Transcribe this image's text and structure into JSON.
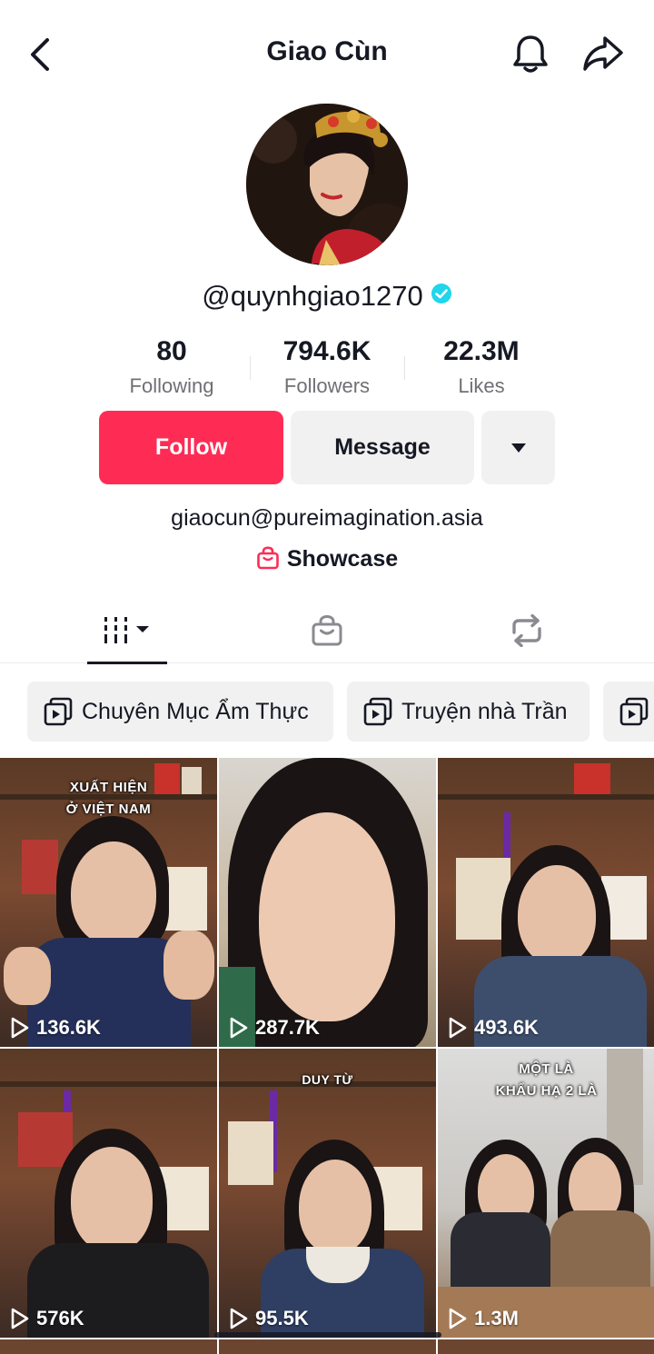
{
  "header": {
    "title": "Giao Cùn",
    "back_icon": "chevron-left-icon",
    "bell_icon": "bell-icon",
    "share_icon": "share-arrow-icon"
  },
  "profile": {
    "username": "@quynhgiao1270",
    "verified": true,
    "verified_color": "#20d5ec"
  },
  "stats": [
    {
      "value": "80",
      "label": "Following"
    },
    {
      "value": "794.6K",
      "label": "Followers"
    },
    {
      "value": "22.3M",
      "label": "Likes"
    }
  ],
  "actions": {
    "follow_label": "Follow",
    "message_label": "Message",
    "more_icon": "caret-down-icon",
    "follow_color": "#fe2c55"
  },
  "bio": {
    "email": "giaocun@pureimagination.asia",
    "showcase_label": "Showcase",
    "showcase_icon": "shopping-bag-icon"
  },
  "tabs": [
    {
      "name": "videos",
      "icon": "grid-icon",
      "active": true
    },
    {
      "name": "shop",
      "icon": "shop-bag-icon",
      "active": false
    },
    {
      "name": "reposts",
      "icon": "repost-icon",
      "active": false
    }
  ],
  "playlists": [
    {
      "label": "Chuyên Mục Ẩm Thực",
      "icon": "playlist-icon"
    },
    {
      "label": "Truyện nhà Trần",
      "icon": "playlist-icon"
    },
    {
      "label": "",
      "icon": "playlist-icon"
    }
  ],
  "videos": [
    {
      "views": "136.6K",
      "caption_line1": "XUẤT HIỆN",
      "caption_line2": "Ở VIỆT NAM"
    },
    {
      "views": "287.7K",
      "caption_line1": "",
      "caption_line2": ""
    },
    {
      "views": "493.6K",
      "caption_line1": "",
      "caption_line2": ""
    },
    {
      "views": "576K",
      "caption_line1": "",
      "caption_line2": ""
    },
    {
      "views": "95.5K",
      "caption_line1": "DUY TỪ",
      "caption_line2": ""
    },
    {
      "views": "1.3M",
      "caption_line1": "MỘT LÀ",
      "caption_line2": "KHẨU HẠ 2 LÀ"
    }
  ]
}
